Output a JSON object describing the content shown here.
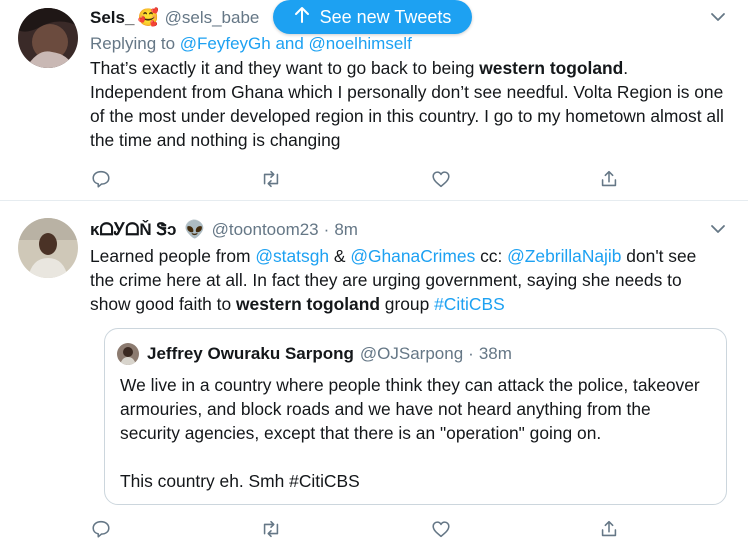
{
  "colors": {
    "accent": "#1da1f2",
    "muted": "#657786",
    "text": "#14171a",
    "border": "#e6ecf0"
  },
  "pill": {
    "label": "See new Tweets",
    "icon": "arrow-up-icon"
  },
  "tweet1": {
    "name": "Sels_",
    "emoji": "🥰",
    "handle": "@sels_babe",
    "replying_prefix": "Replying to ",
    "replying_user1": "@FeyfeyGh",
    "replying_and": " and ",
    "replying_user2": "@noelhimself",
    "text_a": "That’s exactly it and they want to go back to being ",
    "text_bold": "western togoland",
    "text_b": ". Independent from Ghana which I personally don’t see needful.  Volta Region is one of the most under developed region in this country. I go to my hometown almost all the time and nothing is changing"
  },
  "tweet2": {
    "name": "ĸᗝᎩᗝŇ Ꮥↄ",
    "emoji": "👽",
    "handle": "@toontoom23",
    "time": "8m",
    "t1": "Learned people from ",
    "m1": "@statsgh",
    "t2": " & ",
    "m2": "@GhanaCrimes",
    "t3": " cc: ",
    "m3": "@ZebrillaNajib",
    "t4": " don't see the crime here at all. In fact they are urging government, saying she needs to show good faith to ",
    "bold": "western togoland",
    "t5": " group ",
    "hashtag": "#CitiCBS"
  },
  "quote": {
    "name": "Jeffrey Owuraku Sarpong",
    "handle": "@OJSarpong",
    "time": "38m",
    "line1": "We live in a country where people think they can attack the police, takeover armouries, and block roads and we have not heard anything from the security agencies, except that there is an \"operation\" going on.",
    "line2": "This country eh. Smh #CitiCBS"
  }
}
